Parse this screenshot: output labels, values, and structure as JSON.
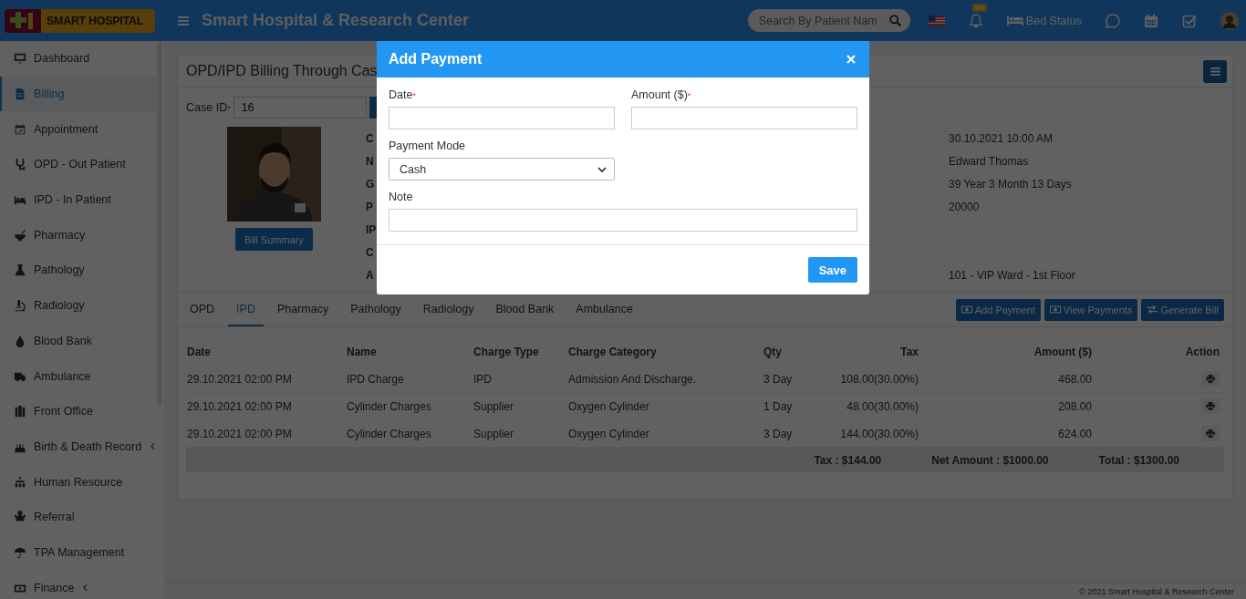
{
  "header": {
    "logo": "SMART HOSPITAL",
    "title": "Smart Hospital & Research Center",
    "search": {
      "placeholder": "Search By Patient Nam"
    },
    "notifications": "589",
    "bed_status": "Bed Status"
  },
  "sidebar": [
    {
      "label": "Dashboard",
      "selected": false,
      "expandable": false
    },
    {
      "label": "Billing",
      "selected": true,
      "expandable": false
    },
    {
      "label": "Appointment",
      "selected": false,
      "expandable": false
    },
    {
      "label": "OPD - Out Patient",
      "selected": false,
      "expandable": false
    },
    {
      "label": "IPD - In Patient",
      "selected": false,
      "expandable": false
    },
    {
      "label": "Pharmacy",
      "selected": false,
      "expandable": false
    },
    {
      "label": "Pathology",
      "selected": false,
      "expandable": false
    },
    {
      "label": "Radiology",
      "selected": false,
      "expandable": false
    },
    {
      "label": "Blood Bank",
      "selected": false,
      "expandable": false
    },
    {
      "label": "Ambulance",
      "selected": false,
      "expandable": false
    },
    {
      "label": "Front Office",
      "selected": false,
      "expandable": false
    },
    {
      "label": "Birth & Death Record",
      "selected": false,
      "expandable": true
    },
    {
      "label": "Human Resource",
      "selected": false,
      "expandable": false
    },
    {
      "label": "Referral",
      "selected": false,
      "expandable": false
    },
    {
      "label": "TPA Management",
      "selected": false,
      "expandable": false
    },
    {
      "label": "Finance",
      "selected": false,
      "expandable": true
    }
  ],
  "page": {
    "title": "OPD/IPD Billing Through Cas",
    "case_id": {
      "label": "Case ID",
      "required_mark": "*",
      "value": "16"
    },
    "bill_summary": "Bill Summary",
    "info": [
      {
        "label": "C",
        "value": "30.10.2021 10:00 AM"
      },
      {
        "label": "N",
        "value": "Edward Thomas"
      },
      {
        "label": "G",
        "value": "39 Year 3 Month 13 Days"
      },
      {
        "label": "P",
        "value": "20000"
      },
      {
        "label": "IP"
      },
      {
        "label": "C"
      },
      {
        "label": "A",
        "value": "101 - VIP Ward - 1st Floor"
      }
    ]
  },
  "tabs": [
    {
      "label": "OPD",
      "selected": false
    },
    {
      "label": "IPD",
      "selected": true
    },
    {
      "label": "Pharmacy",
      "selected": false
    },
    {
      "label": "Pathology",
      "selected": false
    },
    {
      "label": "Radiology",
      "selected": false
    },
    {
      "label": "Blood Bank",
      "selected": false
    },
    {
      "label": "Ambulance",
      "selected": false
    }
  ],
  "actions": [
    {
      "label": "Add Payment",
      "kind": "money"
    },
    {
      "label": "View Payments",
      "kind": "money"
    },
    {
      "label": "Generate Bill",
      "kind": "exchange"
    }
  ],
  "table": {
    "columns": [
      "Date",
      "Name",
      "Charge Type",
      "Charge Category",
      "Qty",
      "Tax",
      "Amount ($)",
      "Action"
    ],
    "rows": [
      [
        "29.10.2021 02:00 PM",
        "IPD Charge",
        "IPD",
        "Admission And Discharge.",
        "3 Day",
        "108.00(30.00%)",
        "468.00"
      ],
      [
        "29.10.2021 02:00 PM",
        "Cylinder Charges",
        "Supplier",
        "Oxygen Cylinder",
        "1 Day",
        "48.00(30.00%)",
        "208.00"
      ],
      [
        "29.10.2021 02:00 PM",
        "Cylinder Charges",
        "Supplier",
        "Oxygen Cylinder",
        "3 Day",
        "144.00(30.00%)",
        "624.00"
      ]
    ],
    "totals": [
      "Tax : $144.00",
      "Net Amount : $1000.00",
      "Total : $1300.00"
    ]
  },
  "modal": {
    "title": "Add Payment",
    "fields": [
      {
        "label": "Date",
        "required_mark": "*",
        "kind": "input"
      },
      {
        "label": "Amount ($)",
        "required_mark": "*",
        "kind": "input"
      },
      {
        "label": "Payment Mode",
        "kind": "select",
        "value": "Cash"
      },
      {
        "label": "Note",
        "kind": "wide"
      }
    ],
    "save": "Save"
  },
  "footer": "© 2021 Smart Hospital & Research Center"
}
